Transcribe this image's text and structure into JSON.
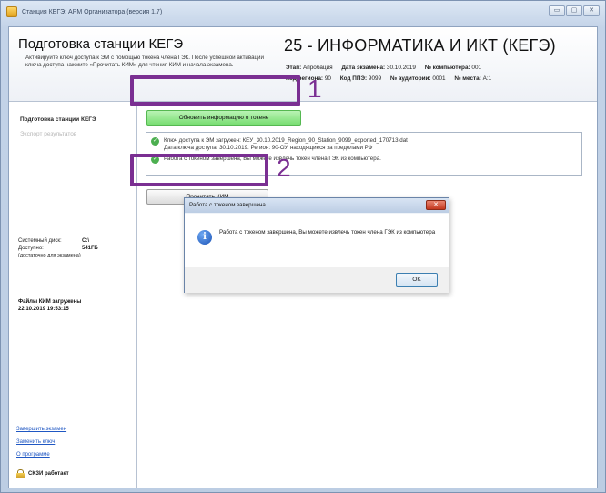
{
  "window": {
    "title": "Станция КЕГЭ: АРМ Организатора (версия 1.7)",
    "controls": [
      "▭",
      "▢",
      "✕"
    ]
  },
  "header": {
    "title": "Подготовка станции КЕГЭ",
    "description": "Активируйте ключ доступа к ЭМ с помощью токена члена ГЭК. После успешной активации ключа доступа нажмите «Прочитать КИМ» для чтения КИМ и начала экзамена.",
    "exam_title": "25 - ИНФОРМАТИКА И ИКТ (КЕГЭ)",
    "stage_label": "Этап:",
    "stage_value": "Апробация",
    "date_label": "Дата экзамена:",
    "date_value": "30.10.2019",
    "computer_label": "№ компьютера:",
    "computer_value": "001",
    "region_label": "Код региона:",
    "region_value": "90",
    "ppe_label": "Код ППЭ:",
    "ppe_value": "9099",
    "room_label": "№ аудитории:",
    "room_value": "0001",
    "place_label": "№ места:",
    "place_value": "A:1"
  },
  "sidebar": {
    "nav_active": "Подготовка станции КЕГЭ",
    "nav_disabled": "Экспорт результатов",
    "disk_label": "Системный диск:",
    "disk_value": "C:\\",
    "free_label": "Доступно:",
    "free_value": "541ГБ",
    "free_note": "(достаточно для экзамена)",
    "kim_loaded_label": "Файлы КИМ загружены",
    "kim_loaded_time": "22.10.2019 19:53:15",
    "links": [
      "Завершить экзамен",
      "Заменить ключ",
      "О программе"
    ],
    "skzi_label": "СКЗИ работает"
  },
  "main": {
    "update_button": "Обновить информацию о токене",
    "read_button": "Прочитать КИМ",
    "callout1": "1",
    "callout2": "2",
    "log": [
      {
        "line1": "Ключ доступа к ЭМ загружен: КЕУ_30.10.2019_Region_90_Station_9099_exported_170713.dat",
        "line2": "Дата ключа доступа: 30.10.2019. Регион: 90-ОУ, находящиеся за пределами РФ"
      },
      {
        "line1": "Работа с токеном завершена, Вы можете извлечь токен члена ГЭК из компьютера.",
        "line2": ""
      }
    ]
  },
  "dialog": {
    "title": "Работа с токеном завершена",
    "close_label": "✕",
    "message": "Работа с токеном завершена, Вы можете извлечь токен члена ГЭК из компьютера",
    "ok_label": "OK"
  },
  "colors": {
    "highlight": "#7a2f92",
    "update_button_bg": "#79de73",
    "link": "#1f57c3"
  }
}
